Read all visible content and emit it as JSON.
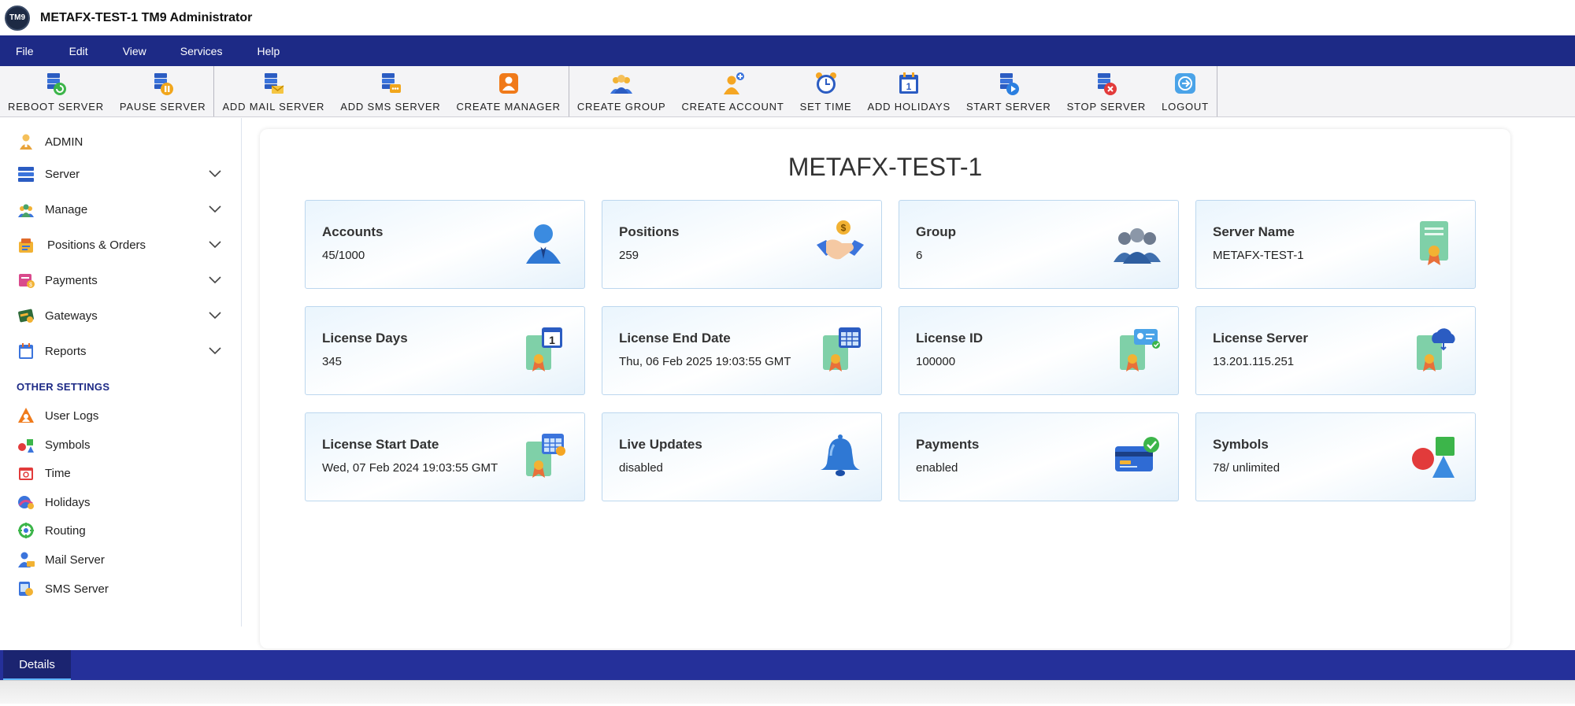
{
  "app": {
    "logo_text": "TM9",
    "title": "METAFX-TEST-1 TM9 Administrator"
  },
  "menu": [
    {
      "label": "File"
    },
    {
      "label": "Edit"
    },
    {
      "label": "View"
    },
    {
      "label": "Services"
    },
    {
      "label": "Help"
    }
  ],
  "toolbar": [
    {
      "label": "REBOOT SERVER",
      "icon": "reboot-server-icon"
    },
    {
      "label": "PAUSE SERVER",
      "icon": "pause-server-icon"
    },
    {
      "label": "ADD MAIL SERVER",
      "icon": "add-mail-server-icon"
    },
    {
      "label": "ADD SMS SERVER",
      "icon": "add-sms-server-icon"
    },
    {
      "label": "CREATE MANAGER",
      "icon": "create-manager-icon"
    },
    {
      "label": "CREATE GROUP",
      "icon": "create-group-icon"
    },
    {
      "label": "CREATE ACCOUNT",
      "icon": "create-account-icon"
    },
    {
      "label": "SET TIME",
      "icon": "alarm-clock-icon"
    },
    {
      "label": "ADD HOLIDAYS",
      "icon": "calendar-icon"
    },
    {
      "label": "START SERVER",
      "icon": "start-server-icon"
    },
    {
      "label": "STOP SERVER",
      "icon": "stop-server-icon"
    },
    {
      "label": "LOGOUT",
      "icon": "logout-icon"
    }
  ],
  "sidebar": {
    "items": [
      {
        "label": "ADMIN",
        "icon": "admin-icon"
      },
      {
        "label": "Server",
        "icon": "server-icon"
      },
      {
        "label": "Manage",
        "icon": "manage-icon"
      },
      {
        "label": "Positions & Orders",
        "icon": "positions-icon"
      },
      {
        "label": "Payments",
        "icon": "payments-icon"
      },
      {
        "label": "Gateways",
        "icon": "gateways-icon"
      },
      {
        "label": "Reports",
        "icon": "reports-icon"
      }
    ],
    "section_title": "OTHER SETTINGS",
    "other": [
      {
        "label": "User Logs",
        "icon": "user-logs-icon"
      },
      {
        "label": "Symbols",
        "icon": "symbols-icon"
      },
      {
        "label": "Time",
        "icon": "time-icon"
      },
      {
        "label": "Holidays",
        "icon": "holidays-icon"
      },
      {
        "label": "Routing",
        "icon": "routing-icon"
      },
      {
        "label": "Mail Server",
        "icon": "mail-server-icon"
      },
      {
        "label": "SMS Server",
        "icon": "sms-server-icon"
      }
    ]
  },
  "main": {
    "title": "METAFX-TEST-1",
    "cards": [
      {
        "title": "Accounts",
        "value": "45/1000",
        "icon": "account-user-icon"
      },
      {
        "title": "Positions",
        "value": "259",
        "icon": "handshake-icon"
      },
      {
        "title": "Group",
        "value": "6",
        "icon": "group-people-icon"
      },
      {
        "title": "Server Name",
        "value": "METAFX-TEST-1",
        "icon": "certificate-icon"
      },
      {
        "title": "License Days",
        "value": "345",
        "icon": "license-calendar-icon"
      },
      {
        "title": "License End Date",
        "value": "Thu, 06 Feb 2025 19:03:55 GMT",
        "icon": "license-calendar-grid-icon"
      },
      {
        "title": "License ID",
        "value": "100000",
        "icon": "license-id-icon"
      },
      {
        "title": "License Server",
        "value": "13.201.115.251",
        "icon": "license-cloud-icon"
      },
      {
        "title": "License Start Date",
        "value": "Wed, 07 Feb 2024 19:03:55 GMT",
        "icon": "license-start-icon"
      },
      {
        "title": "Live Updates",
        "value": "disabled",
        "icon": "bell-icon"
      },
      {
        "title": "Payments",
        "value": "enabled",
        "icon": "credit-card-icon"
      },
      {
        "title": "Symbols",
        "value": "78/ unlimited",
        "icon": "shapes-icon"
      }
    ]
  },
  "bottom": {
    "tab_label": "Details"
  },
  "colors": {
    "menubar": "#1d2a86",
    "bottombar": "#25309a",
    "card_border": "#bcd7ee",
    "section_title": "#1d2a86"
  }
}
